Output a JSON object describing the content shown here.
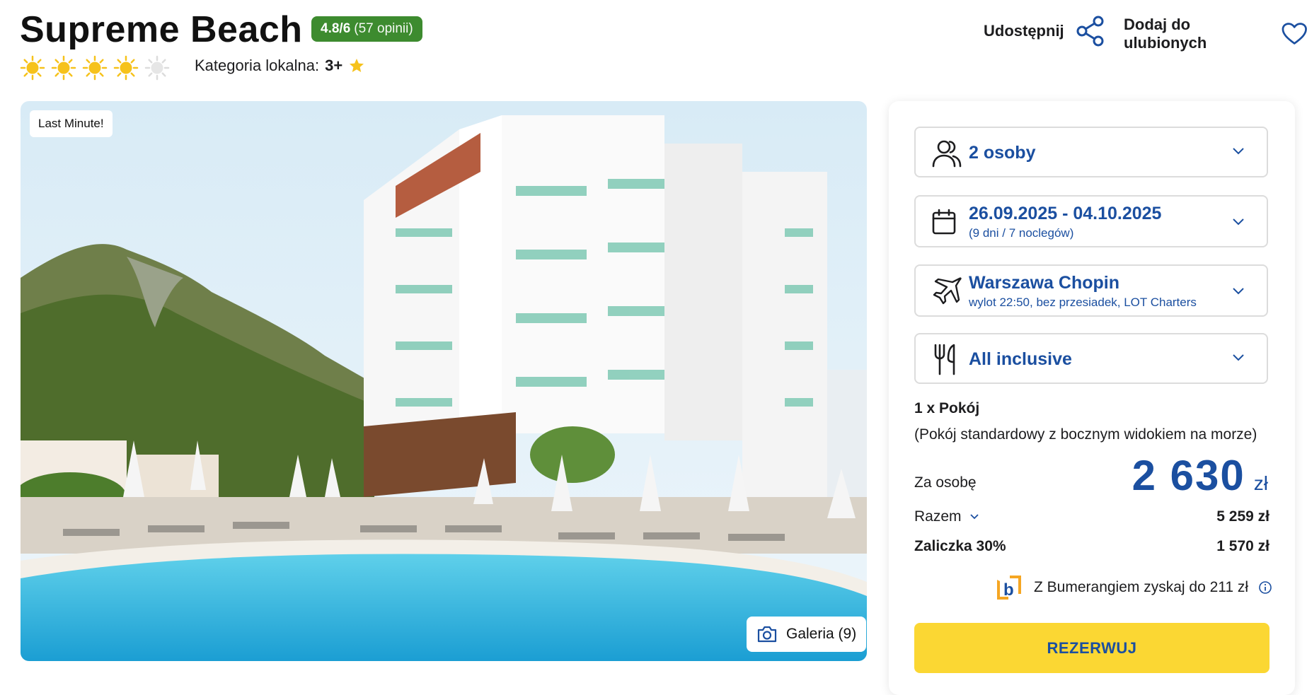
{
  "header": {
    "title": "Supreme Beach",
    "rating_score": "4.8/6",
    "rating_count": "(57 opinii)",
    "stars_total": 5,
    "stars_filled": 4,
    "local_category_label": "Kategoria lokalna:",
    "local_category_value": "3+",
    "share_label": "Udostępnij",
    "favorite_label": "Dodaj do ulubionych"
  },
  "photo": {
    "badge": "Last Minute!",
    "gallery_label": "Galeria (9)"
  },
  "booking": {
    "persons": "2 osoby",
    "dates": "26.09.2025 - 04.10.2025",
    "dates_sub": "(9 dni / 7 noclegów)",
    "departure": "Warszawa Chopin",
    "departure_sub": "wylot 22:50, bez przesiadek, LOT Charters",
    "board": "All inclusive",
    "room_line1": "1 x Pokój",
    "room_line2": "(Pokój standardowy z bocznym widokiem na morze)",
    "per_person_label": "Za osobę",
    "per_person_price": "2 630",
    "currency": "zł",
    "total_label": "Razem",
    "total_value": "5 259 zł",
    "deposit_label": "Zaliczka 30%",
    "deposit_value": "1 570 zł",
    "boomerang_text": "Z Bumerangiem zyskaj do 211 zł",
    "reserve_label": "REZERWUJ"
  },
  "colors": {
    "accent_blue": "#1b4fa0",
    "rating_green": "#3d8b2f",
    "reserve_yellow": "#fbd733",
    "sun_yellow": "#f6c21c"
  }
}
